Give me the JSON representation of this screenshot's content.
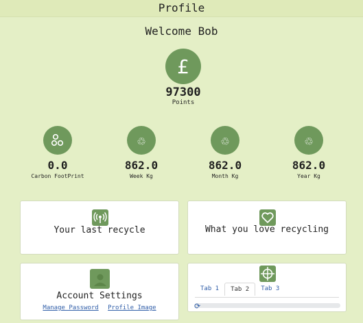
{
  "header": {
    "title": "Profile"
  },
  "welcome": "Welcome Bob",
  "points": {
    "currency_symbol": "£",
    "value": "97300",
    "label": "Points"
  },
  "stats": [
    {
      "value": "0.0",
      "label": "Carbon FootPrint",
      "icon": "molecule-icon"
    },
    {
      "value": "862.0",
      "label": "Week Kg",
      "icon": "recycle-icon"
    },
    {
      "value": "862.0",
      "label": "Month Kg",
      "icon": "recycle-icon"
    },
    {
      "value": "862.0",
      "label": "Year Kg",
      "icon": "recycle-icon"
    }
  ],
  "cards": {
    "last_recycle": {
      "title": "Your last recycle",
      "icon": "broadcast-icon"
    },
    "love_recycling": {
      "title": "What you love recycling",
      "icon": "heart-icon"
    },
    "account": {
      "title": "Account Settings",
      "icon": "user-icon",
      "links": [
        "Manage Password",
        "Profile Image"
      ]
    },
    "tabs": {
      "icon": "crosshair-icon",
      "items": [
        "Tab 1",
        "Tab 2",
        "Tab 3"
      ],
      "active": "Tab 2"
    }
  },
  "colors": {
    "background": "#e4efc6",
    "accent": "#6f995c",
    "link": "#2f5da8"
  }
}
